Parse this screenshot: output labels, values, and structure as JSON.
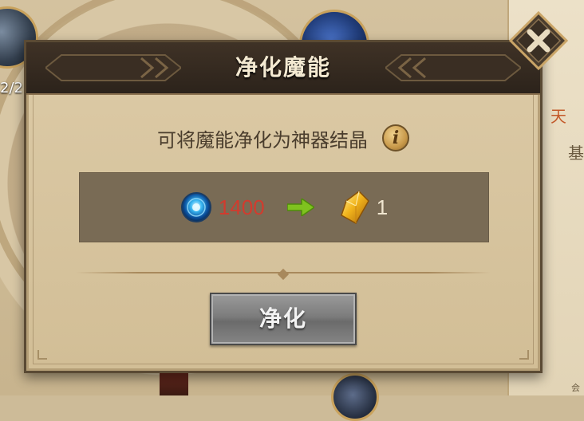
{
  "background": {
    "counter_text": "2/2",
    "right_panel_glyph": "天",
    "right_panel_glyph2": "基",
    "bottom_right_glyph": "会"
  },
  "dialog": {
    "title": "净化魔能",
    "close_icon": "close-x-icon",
    "description": "可将魔能净化为神器结晶",
    "info_icon_label": "i",
    "exchange": {
      "cost_icon": "magic-energy-orb-icon",
      "cost_value": "1400",
      "cost_color": "#d23b2e",
      "arrow_icon": "green-arrow-right-icon",
      "gain_icon": "artifact-crystal-icon",
      "gain_value": "1"
    },
    "action_button_label": "净化"
  }
}
